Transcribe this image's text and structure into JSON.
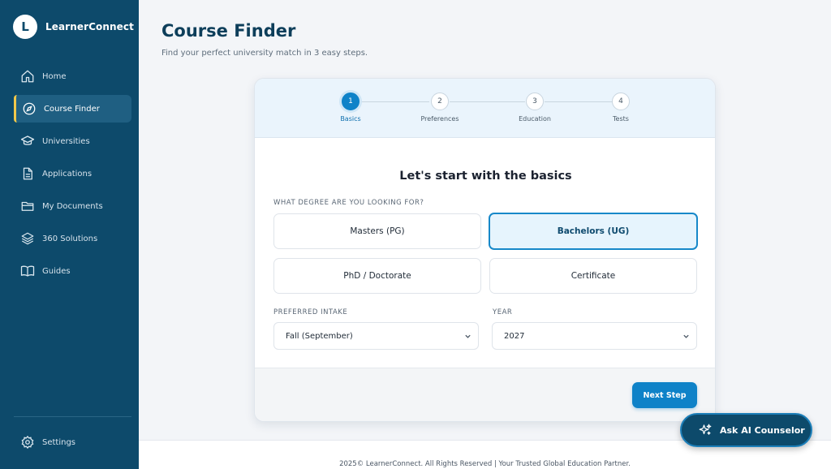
{
  "brand": {
    "logo_letter": "L",
    "name": "LearnerConnect"
  },
  "sidebar": {
    "items": [
      {
        "label": "Home",
        "icon": "home-icon",
        "active": false
      },
      {
        "label": "Course Finder",
        "icon": "compass-icon",
        "active": true
      },
      {
        "label": "Universities",
        "icon": "graduation-cap-icon",
        "active": false
      },
      {
        "label": "Applications",
        "icon": "document-icon",
        "active": false
      },
      {
        "label": "My Documents",
        "icon": "folder-icon",
        "active": false
      },
      {
        "label": "360 Solutions",
        "icon": "layers-icon",
        "active": false
      },
      {
        "label": "Guides",
        "icon": "book-icon",
        "active": false
      }
    ],
    "settings_label": "Settings",
    "settings_icon": "gear-icon"
  },
  "page": {
    "title": "Course Finder",
    "subtitle": "Find your perfect university match in 3 easy steps."
  },
  "stepper": {
    "steps": [
      {
        "number": "1",
        "label": "Basics",
        "active": true
      },
      {
        "number": "2",
        "label": "Preferences",
        "active": false
      },
      {
        "number": "3",
        "label": "Education",
        "active": false
      },
      {
        "number": "4",
        "label": "Tests",
        "active": false
      }
    ]
  },
  "form": {
    "heading": "Let's start with the basics",
    "degree_label": "WHAT DEGREE ARE YOU LOOKING FOR?",
    "degree_options": [
      {
        "label": "Masters (PG)",
        "selected": false
      },
      {
        "label": "Bachelors (UG)",
        "selected": true
      },
      {
        "label": "PhD / Doctorate",
        "selected": false
      },
      {
        "label": "Certificate",
        "selected": false
      }
    ],
    "intake_label": "PREFERRED INTAKE",
    "intake_value": "Fall (September)",
    "year_label": "YEAR",
    "year_value": "2027",
    "next_label": "Next Step"
  },
  "ai_button": {
    "label": "Ask AI Counselor",
    "icon": "sparkle-icon"
  },
  "footer": {
    "text": "2025© LearnerConnect. All Rights Reserved | Your Trusted Global Education Partner."
  },
  "colors": {
    "sidebar_bg": "#0d4a6b",
    "accent": "#0e82c8",
    "active_marker": "#f1c84a"
  }
}
